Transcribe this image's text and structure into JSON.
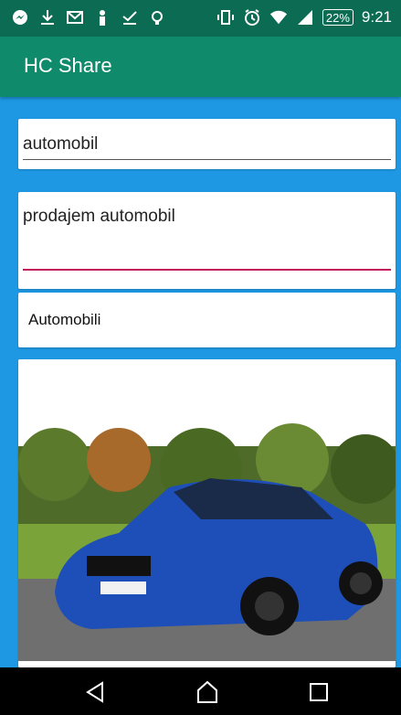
{
  "status_bar": {
    "time": "9:21",
    "battery": "22%",
    "left_icons": [
      "messenger-icon",
      "download-icon",
      "gmail-icon",
      "person-icon",
      "done-icon",
      "lightbulb-icon"
    ],
    "right_icons": [
      "vibrate-icon",
      "alarm-icon",
      "wifi-icon",
      "signal-icon"
    ]
  },
  "app_bar": {
    "title": "HC Share"
  },
  "form": {
    "title_value": "automobil",
    "description_value": "prodajem automobil",
    "category_value": "Automobili"
  },
  "image": {
    "alt": "blue car photo"
  },
  "nav_bar": {
    "buttons": [
      "back-icon",
      "home-icon",
      "recents-icon"
    ]
  },
  "colors": {
    "status_bar": "#0b6b53",
    "app_bar": "#0f8a6b",
    "background": "#1e98e3",
    "focus_underline": "#c2185b"
  }
}
